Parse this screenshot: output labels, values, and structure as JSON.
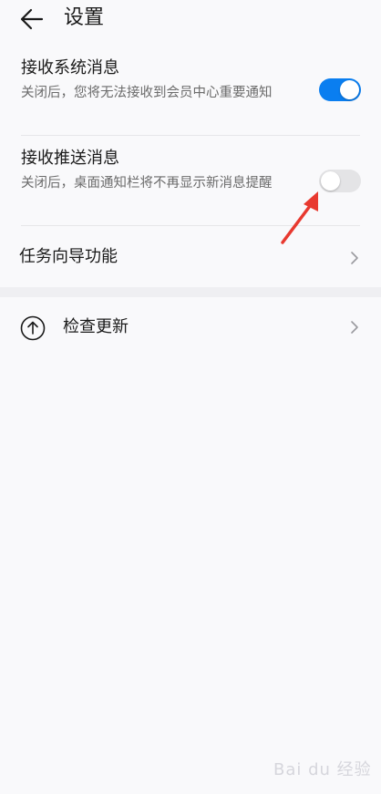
{
  "header": {
    "title": "设置"
  },
  "settings": {
    "system_msg": {
      "title": "接收系统消息",
      "desc": "关闭后，您将无法接收到会员中心重要通知",
      "enabled": true
    },
    "push_msg": {
      "title": "接收推送消息",
      "desc": "关闭后，桌面通知栏将不再显示新消息提醒",
      "enabled": false
    },
    "guide": {
      "title": "任务向导功能"
    }
  },
  "update": {
    "title": "检查更新"
  },
  "watermark": {
    "text": "Bai du 经验"
  },
  "colors": {
    "accent": "#0a7ef0",
    "annotation": "#e8392f",
    "background": "#f9f9fb"
  }
}
